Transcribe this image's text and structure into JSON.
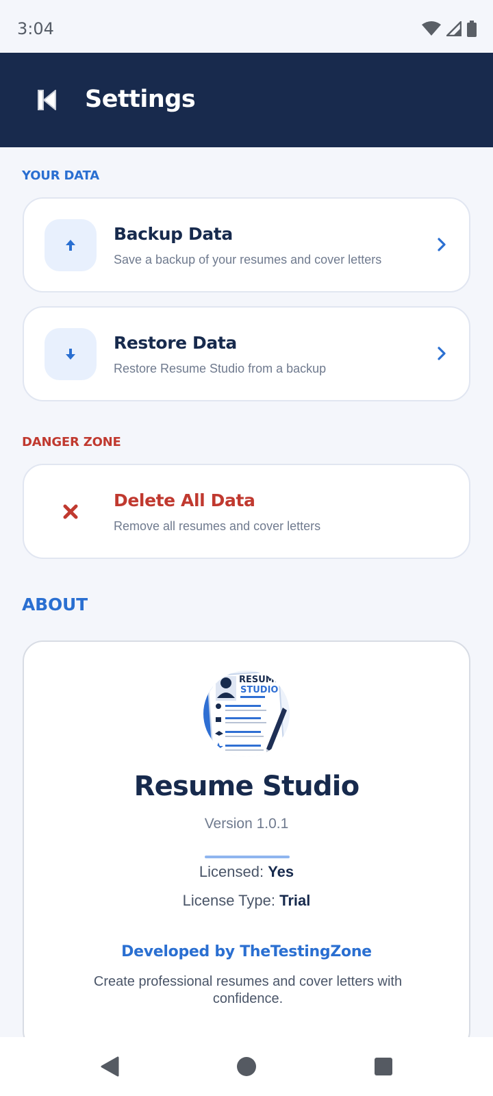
{
  "status": {
    "time": "3:04"
  },
  "header": {
    "title": "Settings"
  },
  "sections": {
    "your_data": "YOUR DATA",
    "danger_zone": "DANGER ZONE",
    "about": "ABOUT"
  },
  "backup": {
    "title": "Backup Data",
    "subtitle": "Save a backup of your resumes and cover letters"
  },
  "restore": {
    "title": "Restore Data",
    "subtitle": "Restore Resume Studio from a backup"
  },
  "delete": {
    "title": "Delete All Data",
    "subtitle": "Remove all resumes and cover letters"
  },
  "about": {
    "logo_text_1": "RESUME",
    "logo_text_2": "STUDIO",
    "app_name": "Resume Studio",
    "version": "Version 1.0.1",
    "licensed_label": "Licensed:",
    "licensed_value": "Yes",
    "license_type_label": "License Type:",
    "license_type_value": "Trial",
    "developer": "Developed by TheTestingZone",
    "description": "Create professional resumes and cover letters with confidence."
  },
  "colors": {
    "header_bg": "#182a4d",
    "accent_blue": "#2a6fd1",
    "danger_red": "#c0392f",
    "background": "#f4f6fb"
  }
}
